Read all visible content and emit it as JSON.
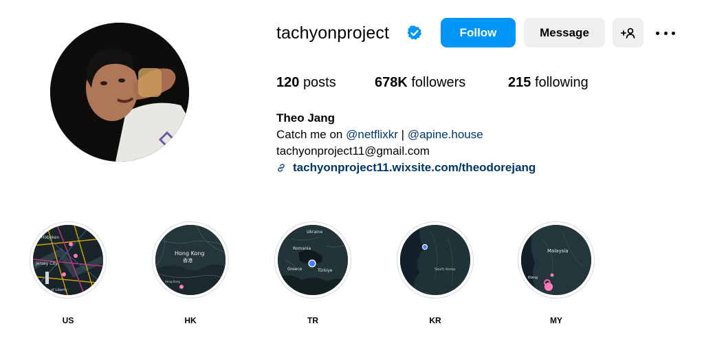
{
  "profile": {
    "username": "tachyonproject",
    "verified_icon": "verified-badge-icon",
    "accent_color": "#0095f6"
  },
  "actions": {
    "follow_label": "Follow",
    "message_label": "Message",
    "add_user_icon": "add-user-icon",
    "more_icon": "more-options-icon"
  },
  "stats": {
    "posts_count": "120",
    "posts_label": "posts",
    "followers_count": "678K",
    "followers_label": "followers",
    "following_count": "215",
    "following_label": "following"
  },
  "bio": {
    "name": "Theo Jang",
    "line_prefix": "Catch me on ",
    "mention_1": "@netflixkr",
    "separator": " | ",
    "mention_2": "@apine.house",
    "email": "tachyonproject11@gmail.com",
    "link": "tachyonproject11.wixsite.com/theodorejang"
  },
  "highlights": [
    {
      "label": "US",
      "map_text": [
        "Hoboken",
        "Jersey City",
        "Statue of Liberty"
      ]
    },
    {
      "label": "HK",
      "map_text": [
        "Hong Kong",
        "香港",
        "Hong Kong"
      ]
    },
    {
      "label": "TR",
      "map_text": [
        "Ukraine",
        "Romania",
        "Greece",
        "Türkiye"
      ]
    },
    {
      "label": "KR",
      "map_text": [
        "South Korea"
      ]
    },
    {
      "label": "MY",
      "map_text": [
        "Malaysia",
        "Klang"
      ]
    }
  ]
}
